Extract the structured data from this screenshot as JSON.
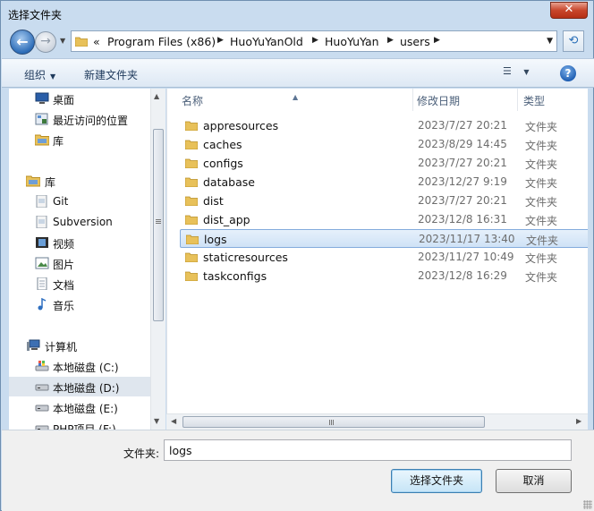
{
  "window": {
    "title": "选择文件夹",
    "close_label": "✕"
  },
  "address": {
    "overflow": "«",
    "segments": [
      "Program Files (x86)",
      "HuoYuYanOld",
      "HuoYuYan",
      "users"
    ]
  },
  "toolbar": {
    "organize": "组织",
    "new_folder": "新建文件夹"
  },
  "nav": {
    "items": [
      {
        "label": "桌面",
        "icon": "desktop-icon"
      },
      {
        "label": "最近访问的位置",
        "icon": "recent-places-icon"
      },
      {
        "label": "库",
        "icon": "library-icon"
      },
      {
        "label": "库",
        "icon": "library-icon"
      },
      {
        "label": "Git",
        "icon": "library-icon"
      },
      {
        "label": "Subversion",
        "icon": "library-icon"
      },
      {
        "label": "视频",
        "icon": "video-icon"
      },
      {
        "label": "图片",
        "icon": "picture-icon"
      },
      {
        "label": "文档",
        "icon": "document-icon"
      },
      {
        "label": "音乐",
        "icon": "music-icon"
      },
      {
        "label": "计算机",
        "icon": "computer-icon"
      },
      {
        "label": "本地磁盘 (C:)",
        "icon": "system-drive-icon"
      },
      {
        "label": "本地磁盘 (D:)",
        "icon": "drive-icon"
      },
      {
        "label": "本地磁盘 (E:)",
        "icon": "drive-icon"
      },
      {
        "label": "PHP项目 (F:)",
        "icon": "drive-icon"
      }
    ]
  },
  "columns": {
    "name": "名称",
    "modified": "修改日期",
    "type": "类型"
  },
  "files": [
    {
      "name": "appresources",
      "date": "2023/7/27 20:21",
      "type": "文件夹"
    },
    {
      "name": "caches",
      "date": "2023/8/29 14:45",
      "type": "文件夹"
    },
    {
      "name": "configs",
      "date": "2023/7/27 20:21",
      "type": "文件夹"
    },
    {
      "name": "database",
      "date": "2023/12/27 9:19",
      "type": "文件夹"
    },
    {
      "name": "dist",
      "date": "2023/7/27 20:21",
      "type": "文件夹"
    },
    {
      "name": "dist_app",
      "date": "2023/12/8 16:31",
      "type": "文件夹"
    },
    {
      "name": "logs",
      "date": "2023/11/17 13:40",
      "type": "文件夹"
    },
    {
      "name": "staticresources",
      "date": "2023/11/27 10:49",
      "type": "文件夹"
    },
    {
      "name": "taskconfigs",
      "date": "2023/12/8 16:29",
      "type": "文件夹"
    }
  ],
  "footer": {
    "folder_label": "文件夹:",
    "folder_value": "logs",
    "select_button": "选择文件夹",
    "cancel_button": "取消"
  }
}
